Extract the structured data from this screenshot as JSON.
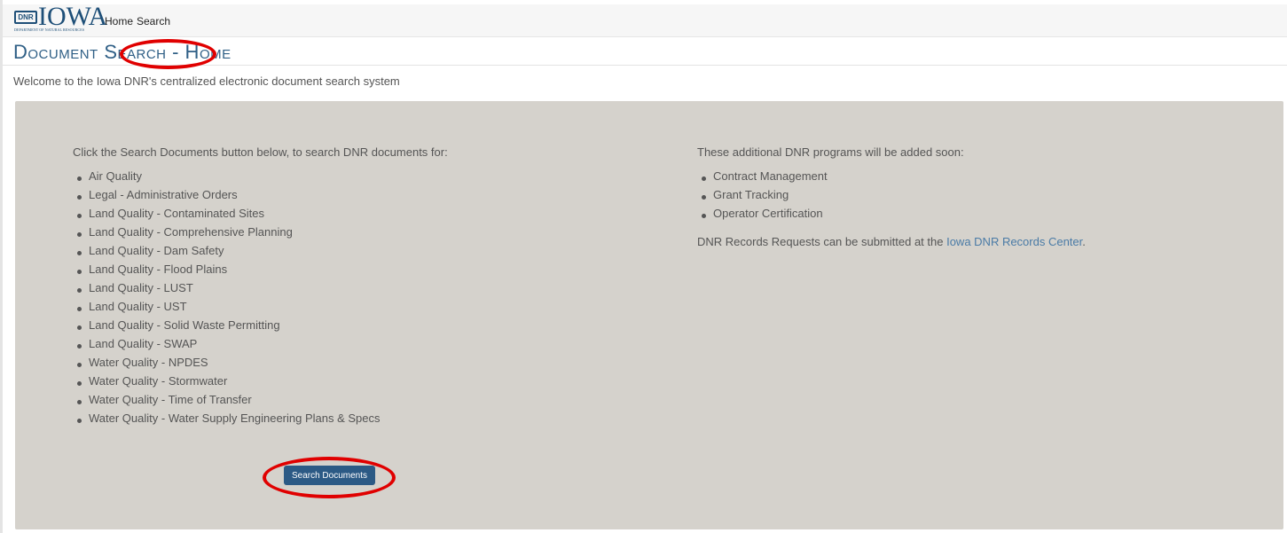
{
  "navbar": {
    "logo": {
      "seal_text": "DNR",
      "wordmark": "IOWA",
      "subtitle": "DEPARTMENT OF NATURAL RESOURCES"
    },
    "links": [
      "Home",
      "Search"
    ]
  },
  "header": {
    "title": "Document Search - Home",
    "welcome": "Welcome to the Iowa DNR's centralized electronic document search system"
  },
  "left_column": {
    "intro": "Click the Search Documents button below, to search DNR documents for:",
    "programs": [
      "Air Quality",
      "Legal - Administrative Orders",
      "Land Quality - Contaminated Sites",
      "Land Quality - Comprehensive Planning",
      "Land Quality - Dam Safety",
      "Land Quality - Flood Plains",
      "Land Quality - LUST",
      "Land Quality - UST",
      "Land Quality - Solid Waste Permitting",
      "Land Quality - SWAP",
      "Water Quality - NPDES",
      "Water Quality - Stormwater",
      "Water Quality - Time of Transfer",
      "Water Quality - Water Supply Engineering Plans & Specs"
    ],
    "button_label": "Search Documents"
  },
  "right_column": {
    "intro": "These additional DNR programs will be added soon:",
    "upcoming": [
      "Contract Management",
      "Grant Tracking",
      "Operator Certification"
    ],
    "records_prefix": "DNR Records Requests can be submitted at the ",
    "records_link": "Iowa DNR Records Center",
    "records_suffix": "."
  },
  "colors": {
    "brand_blue": "#2f5f86",
    "panel_bg": "#d5d2cc",
    "button_bg": "#2c5a85",
    "link": "#4a7ba6",
    "annotation": "#e00000"
  }
}
